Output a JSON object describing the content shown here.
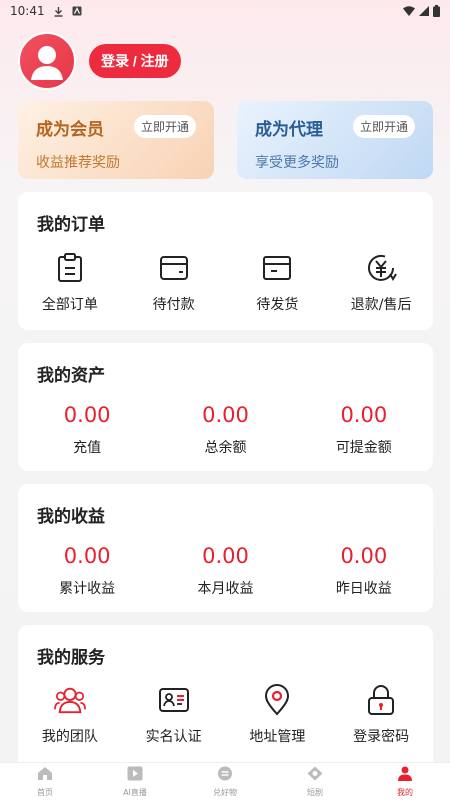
{
  "status_bar": {
    "time": "10:41"
  },
  "profile": {
    "login_label": "登录 / 注册"
  },
  "promos": [
    {
      "title": "成为会员",
      "subtitle": "收益推荐奖励",
      "button": "立即开通"
    },
    {
      "title": "成为代理",
      "subtitle": "享受更多奖励",
      "button": "立即开通"
    }
  ],
  "orders": {
    "title": "我的订单",
    "items": [
      {
        "label": "全部订单",
        "icon": "clipboard-icon"
      },
      {
        "label": "待付款",
        "icon": "wallet-icon"
      },
      {
        "label": "待发货",
        "icon": "package-icon"
      },
      {
        "label": "退款/售后",
        "icon": "refund-icon"
      }
    ]
  },
  "assets": {
    "title": "我的资产",
    "items": [
      {
        "value": "0.00",
        "label": "充值"
      },
      {
        "value": "0.00",
        "label": "总余额"
      },
      {
        "value": "0.00",
        "label": "可提金额"
      }
    ]
  },
  "earnings": {
    "title": "我的收益",
    "items": [
      {
        "value": "0.00",
        "label": "累计收益"
      },
      {
        "value": "0.00",
        "label": "本月收益"
      },
      {
        "value": "0.00",
        "label": "昨日收益"
      }
    ]
  },
  "services": {
    "title": "我的服务",
    "items": [
      {
        "label": "我的团队",
        "icon": "team-icon"
      },
      {
        "label": "实名认证",
        "icon": "id-card-icon"
      },
      {
        "label": "地址管理",
        "icon": "location-icon"
      },
      {
        "label": "登录密码",
        "icon": "lock-icon"
      }
    ]
  },
  "tabbar": {
    "items": [
      {
        "label": "首页",
        "icon": "home-icon"
      },
      {
        "label": "AI直播",
        "icon": "play-icon"
      },
      {
        "label": "兑好物",
        "icon": "exchange-icon"
      },
      {
        "label": "短剧",
        "icon": "drama-icon"
      },
      {
        "label": "我的",
        "icon": "user-icon"
      }
    ],
    "active_index": 4
  },
  "colors": {
    "accent": "#e8202f",
    "button": "#ee2a3f"
  }
}
